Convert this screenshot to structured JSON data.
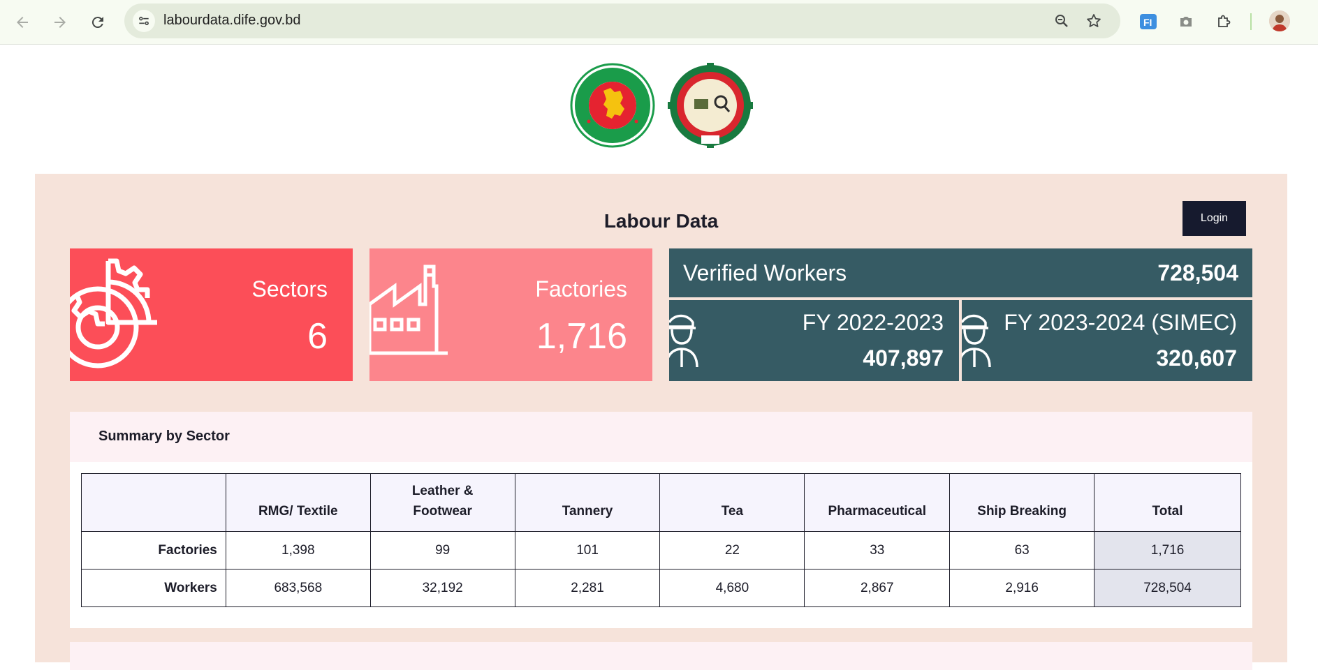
{
  "browser": {
    "url": "labourdata.dife.gov.bd",
    "colors": {
      "toolbar": "#f7fbf2",
      "omnibox": "#e4ebdc"
    },
    "icons": [
      "back-icon",
      "forward-icon",
      "reload-icon",
      "site-info-icon",
      "zoom-icon",
      "bookmark-star-icon",
      "translate-extension-icon",
      "camera-extension-icon",
      "extensions-puzzle-icon",
      "profile-avatar"
    ]
  },
  "page": {
    "logos": [
      "bangladesh-government-seal",
      "dife-seal"
    ],
    "title": "Labour Data",
    "login_label": "Login"
  },
  "stats": {
    "sectors": {
      "label": "Sectors",
      "value": "6",
      "color": "#fc4e58"
    },
    "factories": {
      "label": "Factories",
      "value": "1,716",
      "color": "#fc858c"
    },
    "verified_workers": {
      "label": "Verified Workers",
      "value": "728,504",
      "color": "#365b64"
    },
    "fy1": {
      "label": "FY 2022-2023",
      "value": "407,897"
    },
    "fy2": {
      "label": "FY 2023-2024 (SIMEC)",
      "value": "320,607"
    }
  },
  "summary": {
    "title": "Summary by Sector",
    "columns": [
      "",
      "RMG/ Textile",
      "Leather & Footwear",
      "Tannery",
      "Tea",
      "Pharmaceutical",
      "Ship Breaking",
      "Total"
    ],
    "rows": [
      {
        "label": "Factories",
        "values": [
          "1,398",
          "99",
          "101",
          "22",
          "33",
          "63",
          "1,716"
        ]
      },
      {
        "label": "Workers",
        "values": [
          "683,568",
          "32,192",
          "2,281",
          "4,680",
          "2,867",
          "2,916",
          "728,504"
        ]
      }
    ]
  }
}
